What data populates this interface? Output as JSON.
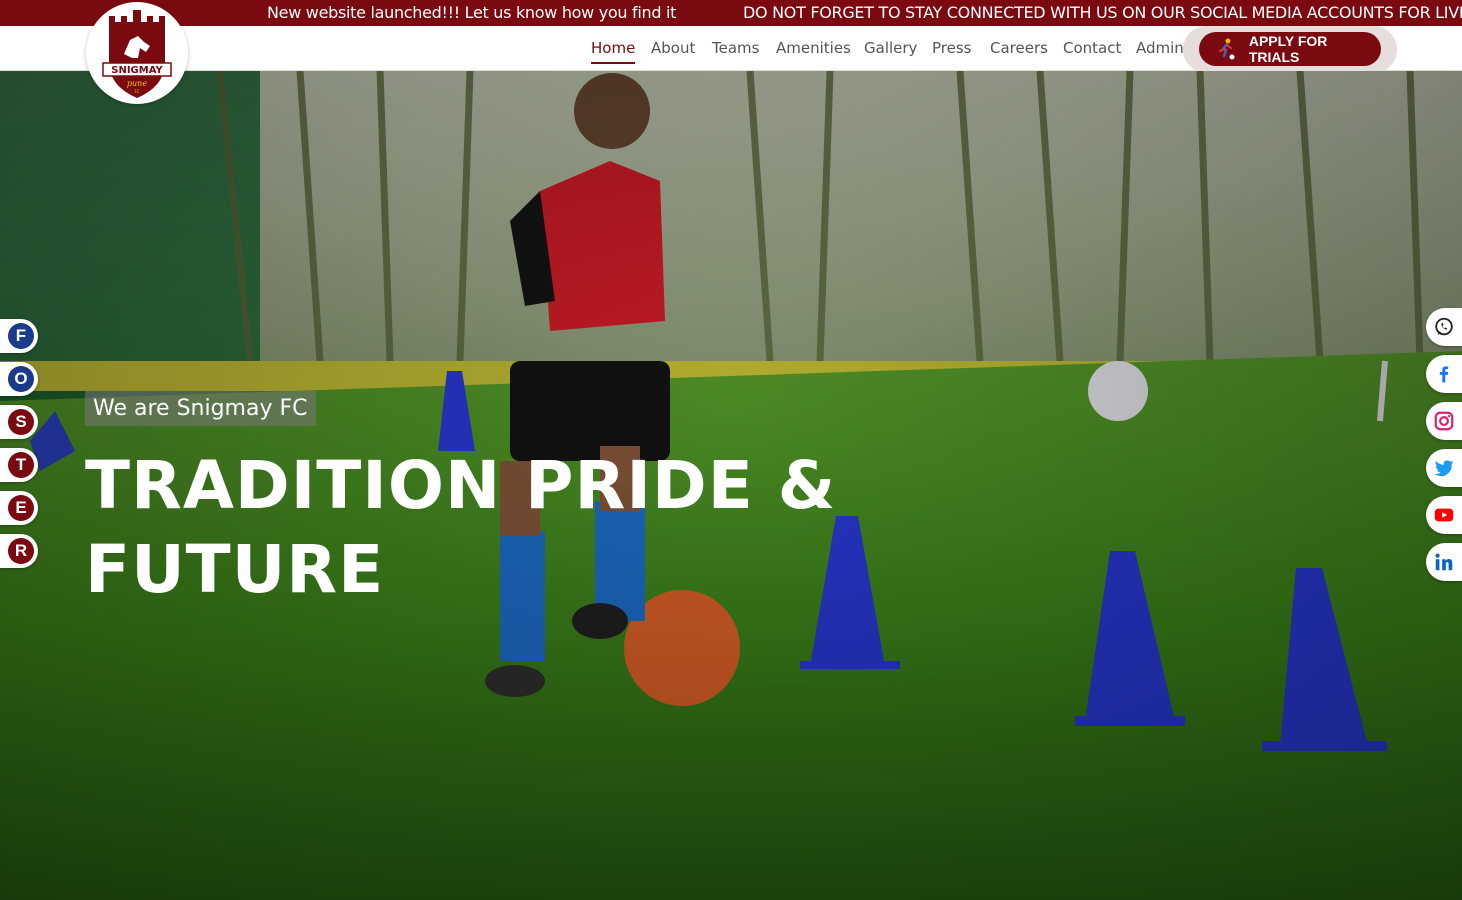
{
  "ticker": {
    "message_1": "New website launched!!! Let us know how you find it",
    "message_2": "DO NOT FORGET TO STAY CONNECTED WITH US ON OUR SOCIAL MEDIA ACCOUNTS FOR LIVE UPDA"
  },
  "logo": {
    "name": "SNIGMAY",
    "sub": "pune",
    "fc": "FC"
  },
  "nav": {
    "items": [
      {
        "label": "Home",
        "active": true
      },
      {
        "label": "About"
      },
      {
        "label": "Teams"
      },
      {
        "label": "Amenities"
      },
      {
        "label": "Gallery"
      },
      {
        "label": "Press"
      },
      {
        "label": "Careers"
      },
      {
        "label": "Contact"
      },
      {
        "label": "Admin"
      }
    ],
    "cta_label": "APPLY FOR TRIALS",
    "cta_icon": "footballer-icon"
  },
  "hero": {
    "tagline": "We are Snigmay FC",
    "headline_line1": "TRADITION PRIDE &",
    "headline_line2": "FUTURE"
  },
  "side_letters": [
    {
      "letter": "F",
      "color": "#1b3a8a"
    },
    {
      "letter": "O",
      "color": "#1b3a8a"
    },
    {
      "letter": "S",
      "color": "#7a0a10"
    },
    {
      "letter": "T",
      "color": "#7a0a10"
    },
    {
      "letter": "E",
      "color": "#7a0a10"
    },
    {
      "letter": "R",
      "color": "#7a0a10"
    }
  ],
  "socials": [
    "whatsapp-icon",
    "facebook-icon",
    "instagram-icon",
    "twitter-icon",
    "youtube-icon",
    "linkedin-icon"
  ],
  "colors": {
    "brand": "#7a0a10",
    "accent_blue": "#1b3a8a"
  }
}
